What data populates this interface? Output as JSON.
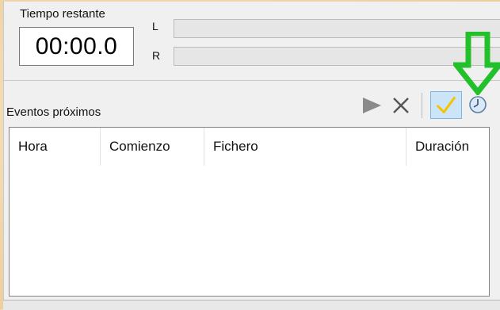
{
  "time": {
    "label": "Tiempo restante",
    "value": "00:00.0"
  },
  "meters": {
    "left_label": "L",
    "right_label": "R",
    "left_level": 0,
    "right_level": 0
  },
  "events": {
    "label": "Eventos próximos",
    "toolbar": {
      "play_icon": "play-icon",
      "delete_icon": "close-icon",
      "confirm_icon": "checkmark-icon",
      "schedule_icon": "clock-icon"
    },
    "columns": [
      "Hora",
      "Comienzo",
      "Fichero",
      "Duración"
    ],
    "rows": []
  },
  "annotation": {
    "icon": "down-arrow-icon",
    "color": "#22c02a"
  },
  "colors": {
    "check_active_bg": "#cce4f7",
    "check_color": "#f5c400"
  }
}
